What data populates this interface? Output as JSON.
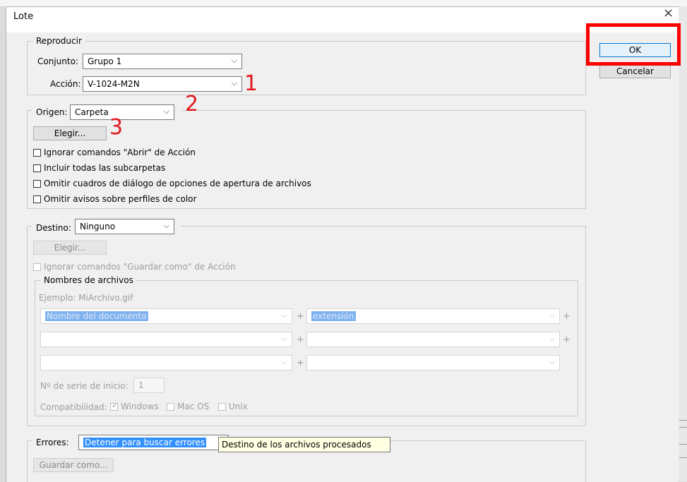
{
  "dialog": {
    "title": "Lote",
    "close_glyph": "×"
  },
  "buttons": {
    "ok": "OK",
    "cancel": "Cancelar"
  },
  "reproducir": {
    "legend": "Reproducir",
    "conjunto_label": "Conjunto:",
    "conjunto_value": "Grupo 1",
    "accion_label": "Acción:",
    "accion_value": "V-1024-M2N"
  },
  "origen": {
    "label": "Origen:",
    "value": "Carpeta",
    "choose_button": "Elegir...",
    "options": [
      {
        "label": "Ignorar comandos \"Abrir\" de Acción",
        "checked": false
      },
      {
        "label": "Incluir todas las subcarpetas",
        "checked": false
      },
      {
        "label": "Omitir cuadros de diálogo de opciones de apertura de archivos",
        "checked": false
      },
      {
        "label": "Omitir avisos sobre perfiles de color",
        "checked": false
      }
    ]
  },
  "destino": {
    "label": "Destino:",
    "value": "Ninguno",
    "choose_button": "Elegir...",
    "ignore_save": "Ignorar comandos \"Guardar como\" de Acción",
    "nombres": {
      "legend": "Nombres de archivos",
      "example": "Ejemplo: MiArchivo.gif",
      "row1_left": "Nombre del documento",
      "row1_right": "extensión",
      "plus": "+",
      "serial_label": "Nº de serie de inicio:",
      "serial_value": "1",
      "compat_label": "Compatibilidad:",
      "compat": [
        {
          "label": "Windows",
          "checked": true
        },
        {
          "label": "Mac OS",
          "checked": false
        },
        {
          "label": "Unix",
          "checked": false
        }
      ]
    }
  },
  "errores": {
    "label": "Errores:",
    "value": "Detener para buscar errores",
    "save_as": "Guardar como...",
    "tooltip": "Destino de los archivos procesados"
  },
  "annotations": {
    "n1": "1",
    "n2": "2",
    "n3": "3",
    "color": "#e0191f"
  },
  "icons": {
    "chevron": "⌵",
    "check": "✓"
  }
}
